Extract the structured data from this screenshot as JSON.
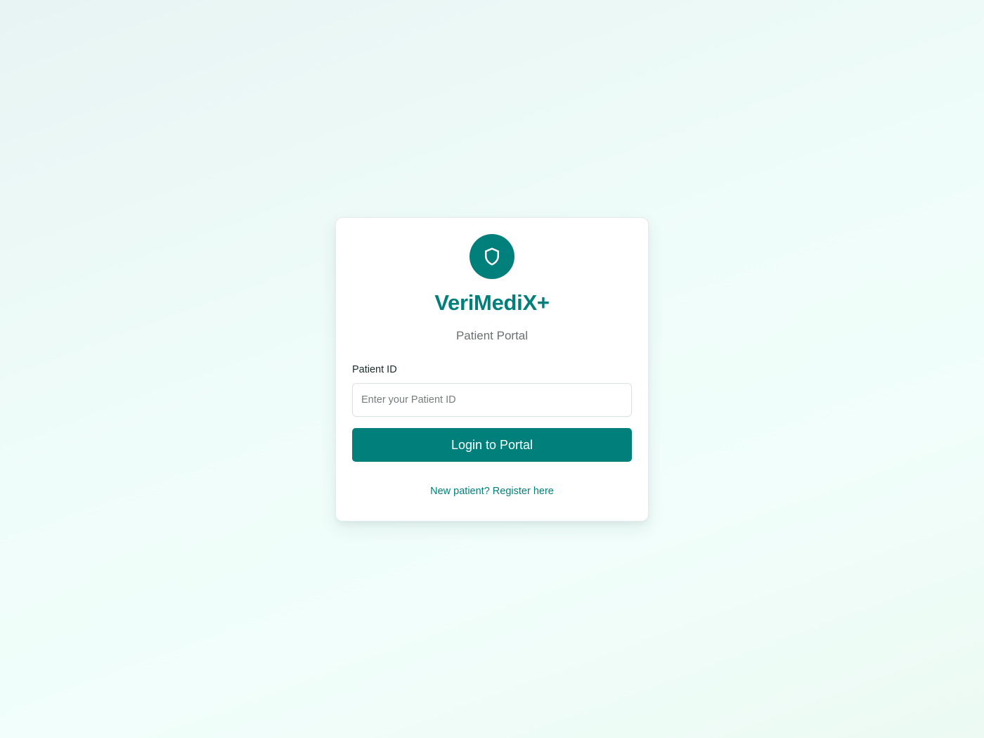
{
  "brand": {
    "title": "VeriMediX+",
    "subtitle": "Patient Portal",
    "logo_icon": "shield-icon"
  },
  "form": {
    "patient_id_label": "Patient ID",
    "patient_id_value": "",
    "patient_id_placeholder": "Enter your Patient ID",
    "login_label": "Login to Portal"
  },
  "register": {
    "link_text": "New patient? Register here"
  },
  "colors": {
    "accent": "#017f7a",
    "card_background": "#ffffff",
    "muted_text": "#6b6f72"
  }
}
